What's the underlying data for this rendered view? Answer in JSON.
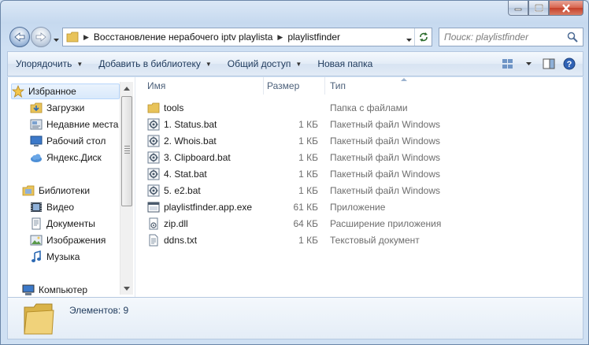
{
  "window": {
    "caption": {
      "minimize": "minimize",
      "maximize": "maximize",
      "close": "close"
    }
  },
  "address": {
    "crumbs": [
      "Восстановление нерабочего iptv playlista",
      "playlistfinder"
    ]
  },
  "search": {
    "placeholder": "Поиск: playlistfinder"
  },
  "toolbar": {
    "organize": "Упорядочить",
    "add_to_library": "Добавить в библиотеку",
    "share": "Общий доступ",
    "new_folder": "Новая папка"
  },
  "nav": {
    "favorites": "Избранное",
    "downloads": "Загрузки",
    "recent": "Недавние места",
    "desktop": "Рабочий стол",
    "yandex_disk": "Яндекс.Диск",
    "libraries": "Библиотеки",
    "video": "Видео",
    "documents": "Документы",
    "pictures": "Изображения",
    "music": "Музыка",
    "computer": "Компьютер"
  },
  "columns": {
    "name": "Имя",
    "size": "Размер",
    "type": "Тип"
  },
  "files": [
    {
      "name": "tools",
      "size": "",
      "type": "Папка с файлами",
      "icon": "folder-icon"
    },
    {
      "name": "1. Status.bat",
      "size": "1 КБ",
      "type": "Пакетный файл Windows",
      "icon": "batch-file-icon"
    },
    {
      "name": "2. Whois.bat",
      "size": "1 КБ",
      "type": "Пакетный файл Windows",
      "icon": "batch-file-icon"
    },
    {
      "name": "3. Clipboard.bat",
      "size": "1 КБ",
      "type": "Пакетный файл Windows",
      "icon": "batch-file-icon"
    },
    {
      "name": "4. Stat.bat",
      "size": "1 КБ",
      "type": "Пакетный файл Windows",
      "icon": "batch-file-icon"
    },
    {
      "name": "5. e2.bat",
      "size": "1 КБ",
      "type": "Пакетный файл Windows",
      "icon": "batch-file-icon"
    },
    {
      "name": "playlistfinder.app.exe",
      "size": "61 КБ",
      "type": "Приложение",
      "icon": "exe-file-icon"
    },
    {
      "name": "zip.dll",
      "size": "64 КБ",
      "type": "Расширение приложения",
      "icon": "dll-file-icon"
    },
    {
      "name": "ddns.txt",
      "size": "1 КБ",
      "type": "Текстовый документ",
      "icon": "text-file-icon"
    }
  ],
  "details": {
    "count": "Элементов: 9"
  }
}
